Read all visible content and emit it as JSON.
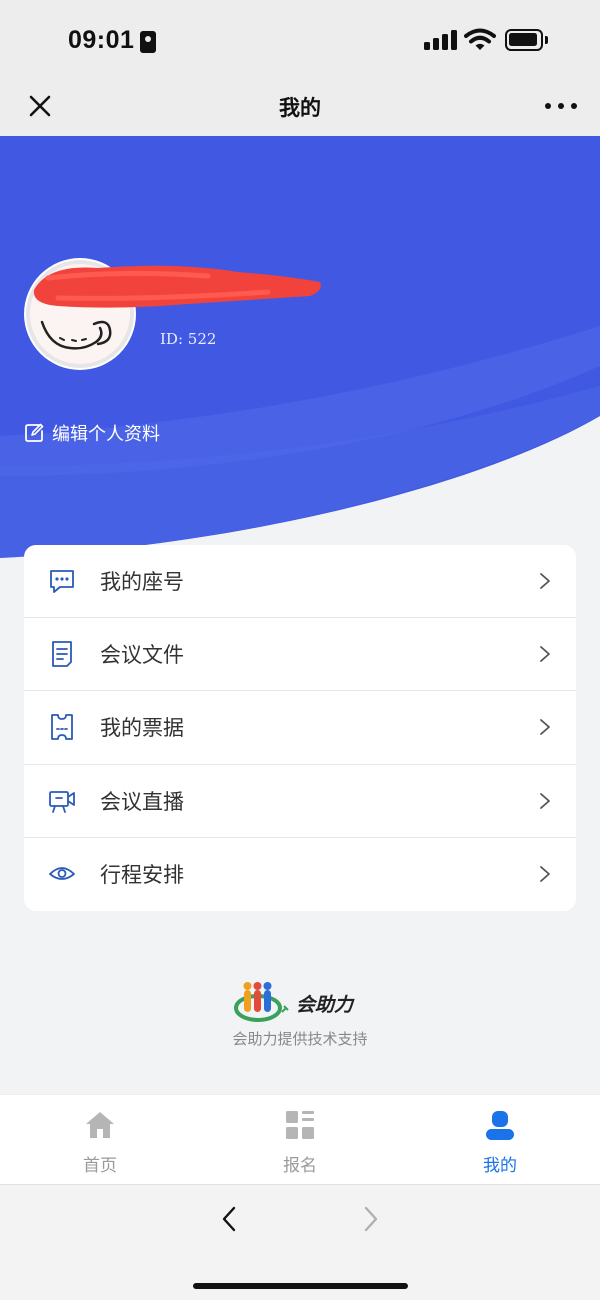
{
  "status_bar": {
    "time": "09:01"
  },
  "nav": {
    "title": "我的"
  },
  "profile": {
    "user_id": "ID: 522",
    "edit_label": "编辑个人资料",
    "hero_color": "#4158e3"
  },
  "menu": {
    "items": [
      {
        "label": "我的座号",
        "icon": "seat-chat-icon"
      },
      {
        "label": "会议文件",
        "icon": "document-icon"
      },
      {
        "label": "我的票据",
        "icon": "ticket-icon"
      },
      {
        "label": "会议直播",
        "icon": "live-camera-icon"
      },
      {
        "label": "行程安排",
        "icon": "eye-icon"
      }
    ]
  },
  "brand": {
    "logo_text": "会助力",
    "support_text": "会助力提供技术支持"
  },
  "tabs": [
    {
      "label": "首页",
      "icon": "home-icon",
      "active": false
    },
    {
      "label": "报名",
      "icon": "grid-icon",
      "active": false
    },
    {
      "label": "我的",
      "icon": "user-icon",
      "active": true
    }
  ],
  "colors": {
    "accent": "#1a73e8",
    "hero": "#4158e3",
    "icon_blue": "#2a5bb8"
  }
}
